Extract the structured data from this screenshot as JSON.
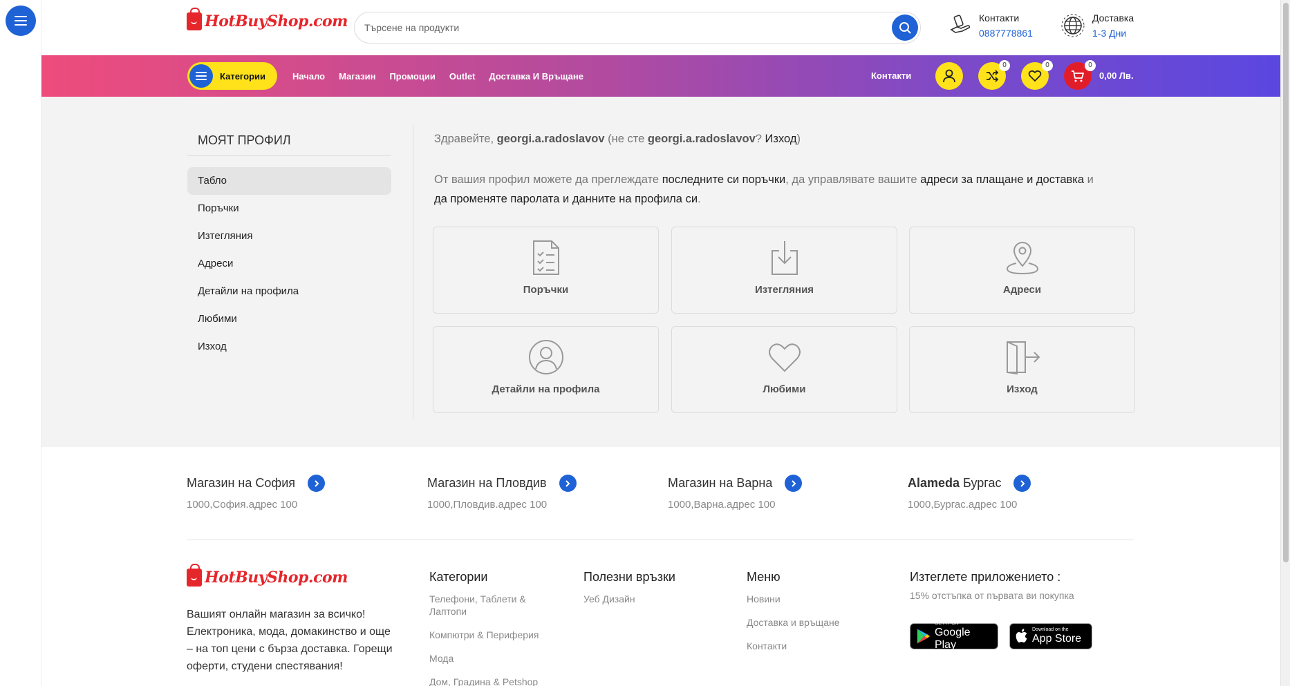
{
  "header": {
    "logo_text": "HotBuyShop.com",
    "search_placeholder": "Търсене на продукти",
    "contacts_label": "Контакти",
    "contacts_phone": "0887778861",
    "delivery_label": "Доставка",
    "delivery_value": "1-3 Дни"
  },
  "nav": {
    "categories_label": "Категории",
    "links": [
      "Начало",
      "Магазин",
      "Промоции",
      "Outlet",
      "Доставка И Връщане"
    ],
    "contacts": "Контакти",
    "compare_count": "0",
    "wishlist_count": "0",
    "cart_count": "0",
    "cart_total": "0,00 Лв."
  },
  "account": {
    "title": "МОЯТ ПРОФИЛ",
    "menu": [
      "Табло",
      "Поръчки",
      "Изтегляния",
      "Адреси",
      "Детайли на профила",
      "Любими",
      "Изход"
    ],
    "active_index": 0,
    "greeting": {
      "prefix": "Здравейте, ",
      "username": "georgi.a.radoslavov",
      "mid": " (не сте ",
      "username2": "georgi.a.radoslavov",
      "q": "? ",
      "logout": "Изход",
      "suffix": ")"
    },
    "intro": {
      "p1": "От вашия профил можете да преглеждате ",
      "l1": "последните си поръчки",
      "p2": ", да управлявате вашите ",
      "l2": "адреси за плащане и доставка",
      "p3": " и ",
      "l3": "да променяте паролата и данните на профила си",
      "p4": "."
    },
    "cards": [
      {
        "label": "Поръчки",
        "icon": "orders-icon"
      },
      {
        "label": "Изтегляния",
        "icon": "download-icon"
      },
      {
        "label": "Адреси",
        "icon": "location-pin-icon"
      },
      {
        "label": "Детайли на профила",
        "icon": "user-icon"
      },
      {
        "label": "Любими",
        "icon": "heart-icon"
      },
      {
        "label": "Изход",
        "icon": "logout-icon"
      }
    ]
  },
  "stores": [
    {
      "name": "Магазин на София",
      "address": "1000,София.адрес 100"
    },
    {
      "name": "Магазин на Пловдив",
      "address": "1000,Пловдив.адрес 100"
    },
    {
      "name": "Магазин на Варна",
      "address": "1000,Варна.адрес 100"
    },
    {
      "name_bold": "Alameda",
      "name": " Бургас",
      "address": "1000,Бургас.адрес 100"
    }
  ],
  "footer": {
    "description": "Вашият онлайн магазин за всичко! Електроника, мода, домакинство и още – на топ цени с бърза доставка. Горещи оферти, студени спестявания!",
    "categories_title": "Категории",
    "categories": [
      "Телефони, Таблети & Лаптопи",
      "Компютри & Периферия",
      "Мода",
      "Дом, Градина & Petshop"
    ],
    "links_title": "Полезни връзки",
    "links": [
      "Уеб Дизайн"
    ],
    "menu_title": "Меню",
    "menu": [
      "Новини",
      "Доставка и връщане",
      "Контакти"
    ],
    "app_title": "Изтеглете приложението :",
    "app_subtitle": "15% отстъпка от първата ви покупка",
    "google_small": "GET IT ON",
    "google_big": "Google Play",
    "apple_small": "Download on the",
    "apple_big": "App Store"
  },
  "colors": {
    "accent_blue": "#1f62d6",
    "accent_yellow": "#ffe21a",
    "brand_red": "#e5262b",
    "nav_gradient_start": "#ee4c7c",
    "nav_gradient_end": "#5a47e0"
  }
}
